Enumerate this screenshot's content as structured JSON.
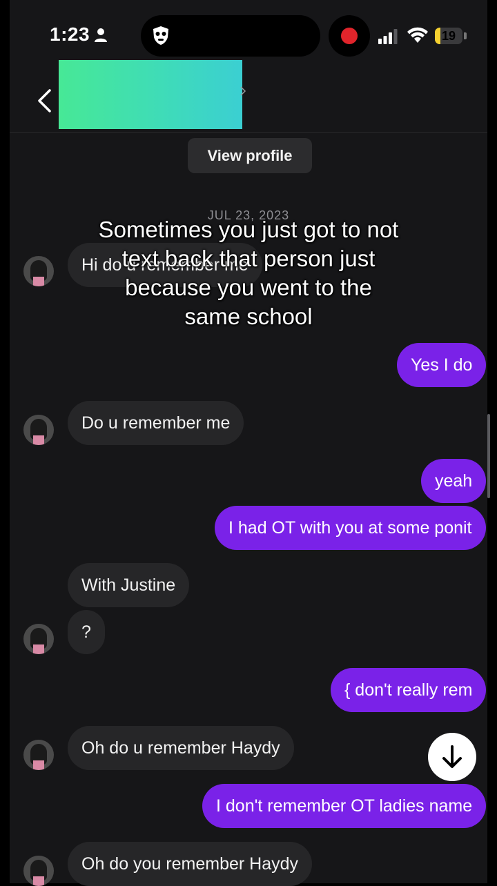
{
  "status_bar": {
    "time": "1:23",
    "battery_level": "19",
    "battery_fraction": 0.19,
    "icons": [
      "person-icon",
      "bug-icon",
      "record-icon",
      "signal-icon",
      "wifi-icon",
      "battery-icon"
    ],
    "record_color": "#e0242b"
  },
  "header": {
    "back_icon": "chevron-left-icon",
    "contact_name_redacted": true
  },
  "view_profile_label": "View profile",
  "date_separator": "JUL 23, 2023",
  "caption": {
    "lines": [
      "Sometimes you just got to not",
      "text back that person just",
      "because you went to the",
      "same school"
    ]
  },
  "messages": [
    {
      "side": "in",
      "text": "Hi do u remember me"
    },
    {
      "side": "out",
      "text": "Yes I do"
    },
    {
      "side": "in",
      "text": "Do u remember me"
    },
    {
      "side": "out",
      "text": "yeah"
    },
    {
      "side": "out",
      "text": "I had OT with you at some ponit"
    },
    {
      "side": "in",
      "text": "With Justine"
    },
    {
      "side": "in",
      "text": "?"
    },
    {
      "side": "out",
      "text": "{ don't really rem"
    },
    {
      "side": "in",
      "text": "Oh do u remember Haydy"
    },
    {
      "side": "out",
      "text": "I don't remember OT  ladies name"
    },
    {
      "side": "in",
      "text": "Oh do you remember Haydy"
    }
  ],
  "colors": {
    "outgoing_bubble": "#7a22e8",
    "incoming_bubble": "#262628",
    "background": "#161618"
  },
  "scroll_button_icon": "arrow-down-icon"
}
